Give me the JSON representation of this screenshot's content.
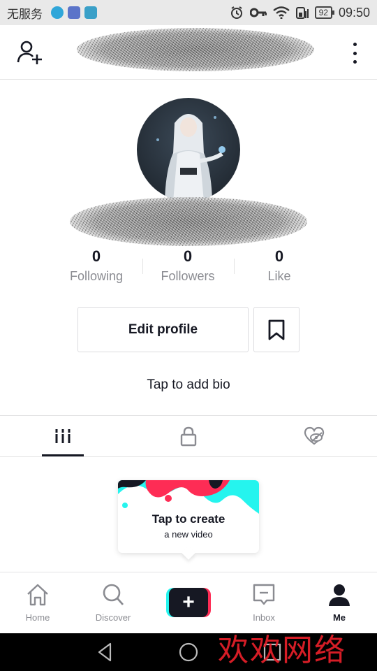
{
  "status_bar": {
    "carrier": "无服务",
    "battery": "92",
    "time": "09:50"
  },
  "header": {
    "add_user_icon": "person-plus-icon",
    "more_icon": "vertical-dots-icon"
  },
  "profile": {
    "avatar_icon": "avatar-photo",
    "stats": [
      {
        "value": "0",
        "label": "Following"
      },
      {
        "value": "0",
        "label": "Followers"
      },
      {
        "value": "0",
        "label": "Like"
      }
    ],
    "edit_label": "Edit profile",
    "bookmark_icon": "bookmark-icon",
    "bio_prompt": "Tap to add bio"
  },
  "tabs": [
    {
      "icon": "grid-icon",
      "active": true
    },
    {
      "icon": "lock-icon",
      "active": false
    },
    {
      "icon": "heart-hidden-icon",
      "active": false
    }
  ],
  "create_card": {
    "title": "Tap to create",
    "subtitle": "a new video"
  },
  "bottom_nav": {
    "items": [
      {
        "label": "Home",
        "icon": "home-icon"
      },
      {
        "label": "Discover",
        "icon": "search-icon"
      },
      {
        "label": "",
        "icon": "plus-icon"
      },
      {
        "label": "Inbox",
        "icon": "inbox-icon"
      },
      {
        "label": "Me",
        "icon": "person-icon"
      }
    ],
    "active_index": 4
  },
  "watermark": "欢欢网络",
  "colors": {
    "text": "#161823",
    "muted": "#8a8b91",
    "border": "#e3e3e4",
    "cyan": "#25f4ee",
    "pink": "#fe2c55",
    "watermark": "#e8202a"
  }
}
